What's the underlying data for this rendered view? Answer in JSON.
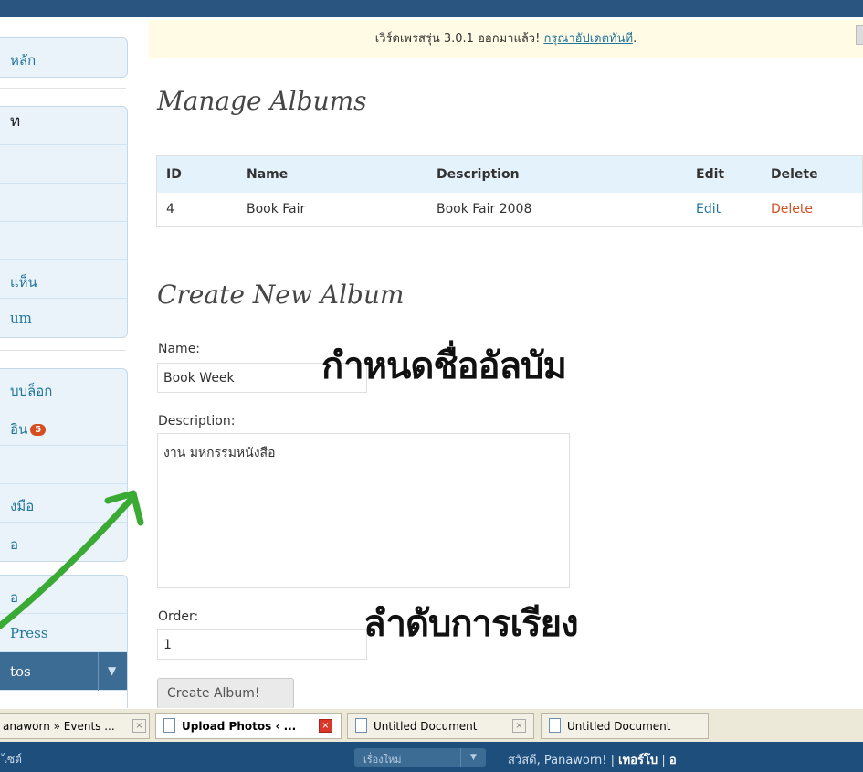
{
  "notice": {
    "text": "เวิร์ดเพรสรุ่น 3.0.1 ออกมาแล้ว! ",
    "link": "กรุณาอัปเดตทันที",
    "suffix": "."
  },
  "sidebar": {
    "items": [
      {
        "label": "หลัก"
      },
      {
        "label": "ท"
      },
      {
        "label": "แห็น"
      },
      {
        "label": "um"
      },
      {
        "label": "บบล็อก"
      },
      {
        "label": "อิน",
        "badge": "5"
      },
      {
        "label": "งมือ"
      },
      {
        "label": "อ"
      },
      {
        "label": "อ"
      },
      {
        "label": "Press"
      },
      {
        "label": "tos"
      }
    ]
  },
  "manage": {
    "title": "Manage Albums",
    "columns": [
      "ID",
      "Name",
      "Description",
      "Edit",
      "Delete"
    ],
    "rows": [
      {
        "id": "4",
        "name": "Book Fair",
        "description": "Book Fair 2008",
        "edit": "Edit",
        "delete": "Delete"
      }
    ]
  },
  "create": {
    "title": "Create New Album",
    "name_label": "Name:",
    "name_value": "Book Week",
    "description_label": "Description:",
    "description_value": "งาน มหกรรมหนังสือ",
    "order_label": "Order:",
    "order_value": "1",
    "button": "Create Album!"
  },
  "annotations": {
    "name_note": "กำหนดชื่ออัลบัม",
    "order_note": "ลำดับการเรียง"
  },
  "taskbar": {
    "tabs": [
      {
        "label": "anaworn » Events ..."
      },
      {
        "label": "Upload Photos ‹ ..."
      },
      {
        "label": "Untitled Document"
      },
      {
        "label": "Untitled Document"
      }
    ]
  },
  "footer": {
    "left": "ไซต์",
    "select": "เรื่องใหม่",
    "greeting": "สวัสดี, Panaworn!",
    "separator": "|",
    "turbo": "เทอร์โบ",
    "tail": "อ"
  },
  "colors": {
    "accent": "#21759b",
    "delete": "#d54e21",
    "arrow": "#3aaa35"
  }
}
